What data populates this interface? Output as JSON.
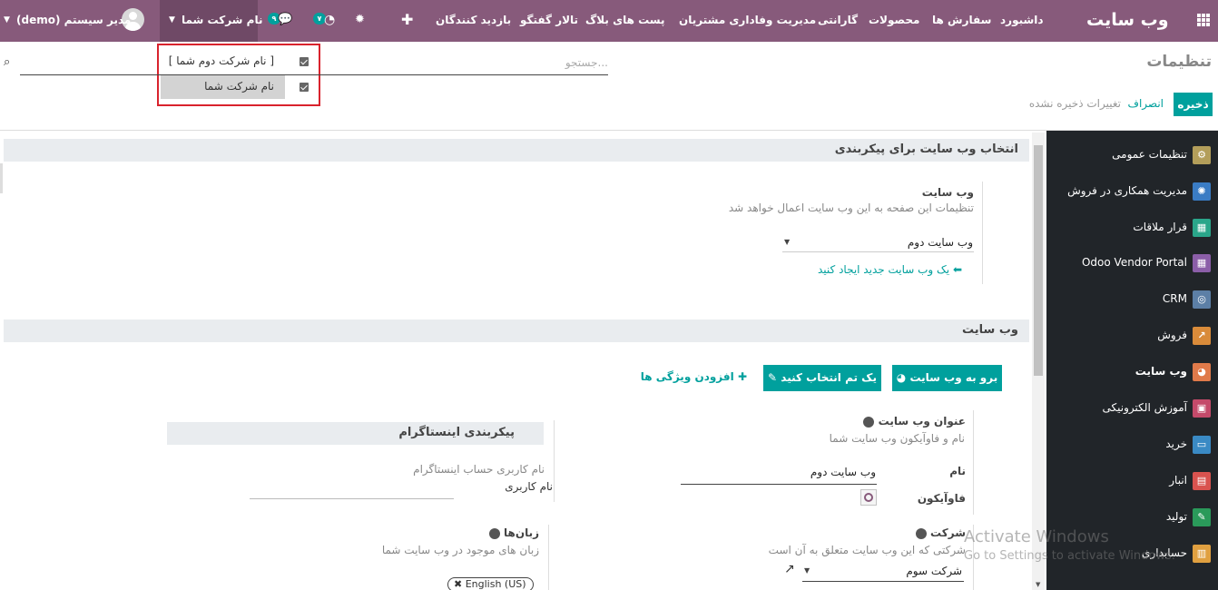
{
  "navbar": {
    "brand": "وب سایت",
    "menu": [
      "داشبورد",
      "سفارش ها",
      "محصولات",
      "گارانتی",
      "مدیریت وفاداری مشتریان",
      "پست های بلاگ",
      "تالار گفتگو",
      "بازدید کنندگان"
    ],
    "add_icon": "plus-icon",
    "bug_icon": "bug-icon",
    "activity_count": "۷",
    "messages_count": "۹",
    "company_switcher": "نام شرکت شما",
    "user": "مدیر سیستم (demo)"
  },
  "company_dropdown": {
    "items": [
      {
        "label": "[ نام شرکت دوم شما ]",
        "checked": true,
        "active": false
      },
      {
        "label": "نام شرکت شما",
        "checked": true,
        "active": true
      }
    ]
  },
  "control_panel": {
    "title": "تنظیمات",
    "search_placeholder": "جستجو...",
    "save_label": "ذخیره",
    "discard_label": "انصراف",
    "status": "تغییرات ذخیره نشده"
  },
  "sidebar": {
    "items": [
      {
        "label": "تنظیمات عمومی",
        "icon": "gear-icon",
        "color": "#b39e5a"
      },
      {
        "label": "مدیریت همکاری در فروش",
        "icon": "handshake-icon",
        "color": "#3a7cc4"
      },
      {
        "label": "قرار ملاقات",
        "icon": "calendar-icon",
        "color": "#2aa68a"
      },
      {
        "label": "Odoo Vendor Portal",
        "icon": "portal-icon",
        "color": "#8b5ea8"
      },
      {
        "label": "CRM",
        "icon": "crm-icon",
        "color": "#5c7fa6"
      },
      {
        "label": "فروش",
        "icon": "chart-icon",
        "color": "#d98b3a"
      },
      {
        "label": "وب سایت",
        "icon": "globe-icon",
        "color": "#e07a4a",
        "active": true
      },
      {
        "label": "آموزش الکترونیکی",
        "icon": "elearning-icon",
        "color": "#c44a6a"
      },
      {
        "label": "خرید",
        "icon": "purchase-icon",
        "color": "#3a8ac4"
      },
      {
        "label": "انبار",
        "icon": "inventory-icon",
        "color": "#d9534f"
      },
      {
        "label": "تولید",
        "icon": "wrench-icon",
        "color": "#2a9a5a"
      },
      {
        "label": "حسابداری",
        "icon": "accounting-icon",
        "color": "#e0a040"
      }
    ]
  },
  "website_select": {
    "section_title": "انتخاب وب سایت برای پیکربندی",
    "label": "وب سایت",
    "description": "تنظیمات این صفحه به این وب سایت اعمال خواهد شد",
    "value": "وب سایت دوم",
    "create_link": "یک وب سایت جدید ایجاد کنید"
  },
  "website_section": {
    "section_title": "وب سایت",
    "go_button": "برو به وب سایت",
    "theme_button": "یک تم انتخاب کنید",
    "features_link": "افزودن ویژگی ها",
    "title_label": "عنوان وب سایت",
    "title_desc": "نام و فاوآیکون وب سایت شما",
    "name_label": "نام",
    "name_value": "وب سایت دوم",
    "favicon_label": "فاوآیکون",
    "instagram_title": "پیکربندی اینستاگرام",
    "instagram_desc": "نام کاربری حساب اینستاگرام",
    "instagram_username_label": "نام کاربری",
    "company_label": "شرکت",
    "company_desc": "شرکتی که این وب سایت متعلق به آن است",
    "company_value": "شرکت سوم",
    "languages_label": "زبان‌ها",
    "languages_desc": "زبان های موجود در وب سایت شما",
    "language_tag": "English (US)"
  },
  "watermark": {
    "line1": "Activate Windows",
    "line2": "Go to Settings to activate Windows."
  }
}
